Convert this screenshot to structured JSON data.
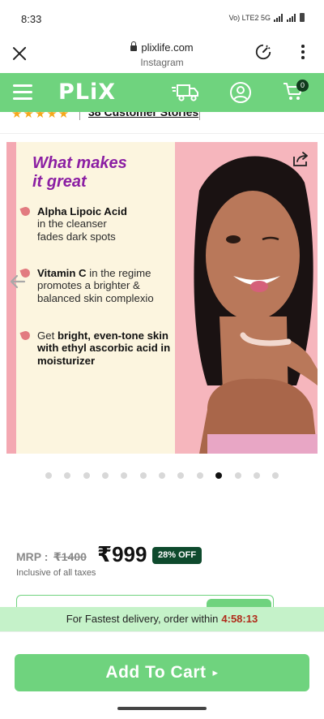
{
  "status_bar": {
    "time": "8:33",
    "network": "Vo) LTE2 5G"
  },
  "browser": {
    "domain": "plixlife.com",
    "source": "Instagram"
  },
  "nav": {
    "logo": "PLiX",
    "cart_count": "0"
  },
  "rating": {
    "stars": "★★★★★",
    "stories_label": "38 Customer Stories"
  },
  "banner": {
    "headline_line1": "What makes",
    "headline_line2": "it great",
    "bullets": [
      {
        "bold": "Alpha Lipoic Acid",
        "rest": "in the cleanser fades dark spots"
      },
      {
        "bold": "Vitamin C",
        "rest": "in the regime promotes a brighter & balanced skin complexio"
      },
      {
        "pre": "Get",
        "bold": "bright, even-tone skin with ethyl ascorbic acid in moisturizer"
      }
    ],
    "colors": {
      "headline": "#8b1ea3",
      "left_bg": "#fcf5df",
      "right_bg": "#f6b6bd"
    }
  },
  "carousel": {
    "total": 13,
    "active": 10
  },
  "price": {
    "mrp_label": "MRP :",
    "mrp_value": "₹1400",
    "sale_price": "₹999",
    "discount": "28% OFF",
    "tax_note": "Inclusive of all taxes"
  },
  "delivery": {
    "text": "For Fastest delivery, order within",
    "timer": "4:58:13"
  },
  "cta": {
    "label": "Add To Cart",
    "chevron": "▸"
  },
  "theme": {
    "brand_green": "#6fd37e",
    "dark_green": "#0e4a2d",
    "timer_red": "#b02a1a"
  }
}
